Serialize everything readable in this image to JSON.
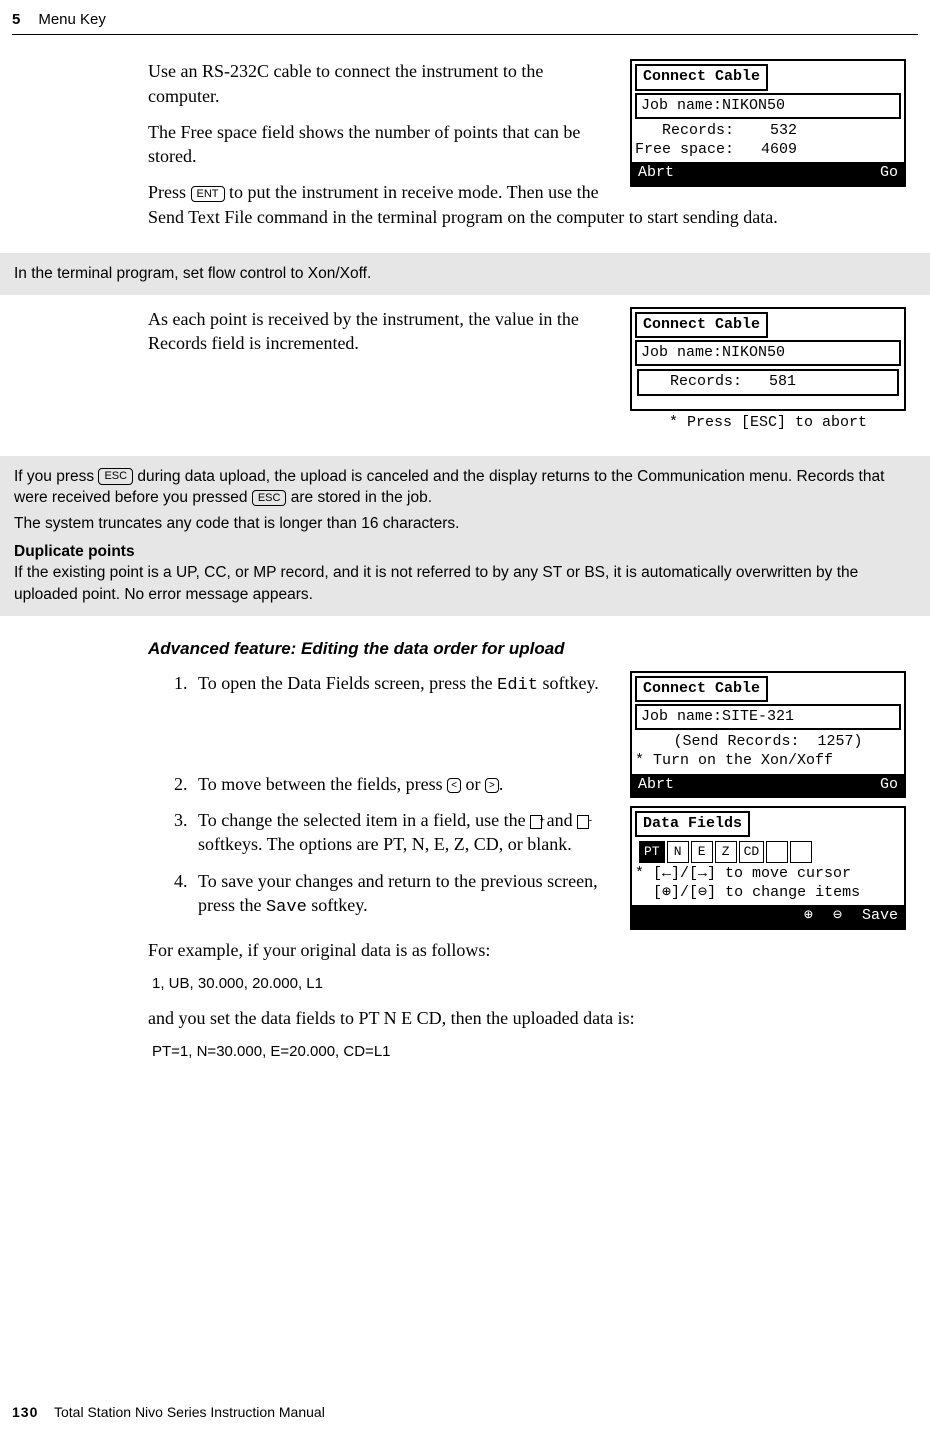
{
  "header": {
    "chapter_num": "5",
    "chapter_title": "Menu Key"
  },
  "body": {
    "p1": "Use an RS-232C cable to connect the instrument to the computer.",
    "p2": "The Free space field shows the number of points that can be stored.",
    "p3a": "Press ",
    "p3_key": "ENT",
    "p3b": " to put the instrument in receive mode. Then use the Send Text File command in the terminal program on the computer to start sending data.",
    "note1": "In the terminal program, set flow control to Xon/Xoff.",
    "p4": "As each point is received by the instrument, the value in the Records field is incremented.",
    "note2": {
      "line1a": "If you press ",
      "key1": "ESC",
      "line1b": " during data upload, the upload is canceled and the display returns to the Communication menu. Records that were received before you pressed ",
      "key2": "ESC",
      "line1c": " are stored in the job.",
      "line2": "The system truncates any code that is longer than 16 characters.",
      "subhead": "Duplicate points",
      "line3": "If the existing point is a UP, CC, or MP record, and it is not referred to by any ST or BS, it is automatically overwritten by the uploaded point. No error message appears."
    },
    "subsection": "Advanced feature: Editing the data order for upload",
    "steps": {
      "s1a": "To open the Data Fields screen, press the ",
      "s1_mono": "Edit",
      "s1b": " softkey.",
      "s2a": "To move between the fields, press ",
      "s2_key1": "<",
      "s2_mid": " or ",
      "s2_key2": ">",
      "s2b": ".",
      "s3a": "To change the selected item in a field, use the ",
      "s3b": " and ",
      "s3c": " softkeys. The options are PT, N, E, Z, CD, or blank.",
      "s4a": "To save your changes and return to the previous screen, press the ",
      "s4_mono": "Save",
      "s4b": " softkey."
    },
    "p5": "For example, if your original data is as follows:",
    "ex1": "1, UB, 30.000, 20.000, L1",
    "p6": "and you set the data fields to PT N E CD, then the uploaded data is:",
    "ex2": "PT=1, N=30.000, E=20.000, CD=L1"
  },
  "figures": {
    "f1": {
      "title": "Connect Cable",
      "job": "Job name:NIKON50",
      "records_label": "Records:",
      "records_val": "532",
      "free_label": "Free space:",
      "free_val": "4609",
      "left_btn": "Abrt",
      "right_btn": "Go"
    },
    "f2": {
      "title": "Connect Cable",
      "job": "Job name:NIKON50",
      "records_label": "Records:",
      "records_val": "581",
      "hint": "* Press [ESC] to abort"
    },
    "f3": {
      "title": "Connect Cable",
      "job": "Job name:SITE-321",
      "send": "(Send Records:  1257)",
      "hint": "* Turn on the Xon/Xoff",
      "left_btn": "Abrt",
      "right_btn": "Go"
    },
    "f4": {
      "title": "Data Fields",
      "cells": [
        "PT",
        "N",
        "E",
        "Z",
        "CD",
        "",
        ""
      ],
      "hint1": "* [←]/[→] to move cursor",
      "hint2": "  [⊕]/[⊖] to change items",
      "btn_left": "⊕",
      "btn_mid": "⊖",
      "btn_right": "Save"
    }
  },
  "footer": {
    "page_num": "130",
    "doc_title": "Total Station Nivo Series Instruction Manual"
  }
}
